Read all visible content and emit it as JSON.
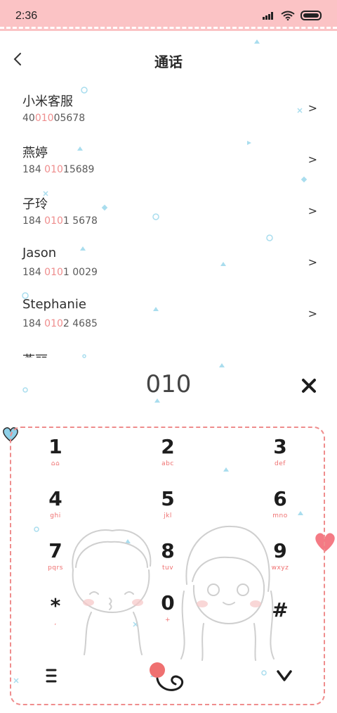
{
  "status_bar": {
    "time": "2:36"
  },
  "header": {
    "title": "通话"
  },
  "contacts": [
    {
      "name": "小米客服",
      "number_pre": "40",
      "number_match": "010",
      "number_post": "05678"
    },
    {
      "name": "燕婷",
      "number_pre": "184 ",
      "number_match": "010",
      "number_post": "15689"
    },
    {
      "name": "子玲",
      "number_pre": "184 ",
      "number_match": "010",
      "number_post": "1 5678"
    },
    {
      "name": "Jason",
      "number_pre": "184 ",
      "number_match": "010",
      "number_post": "1 0029"
    },
    {
      "name": "Stephanie",
      "number_pre": "184 ",
      "number_match": "010",
      "number_post": "2 4685"
    }
  ],
  "contact_partial": "燕丽",
  "contact_arrow": ">",
  "dial": {
    "input": "010"
  },
  "keypad": {
    "keys": [
      {
        "digit": "1",
        "letters": "⌂⌂"
      },
      {
        "digit": "2",
        "letters": "abc"
      },
      {
        "digit": "3",
        "letters": "def"
      },
      {
        "digit": "4",
        "letters": "ghi"
      },
      {
        "digit": "5",
        "letters": "jkl"
      },
      {
        "digit": "6",
        "letters": "mno"
      },
      {
        "digit": "7",
        "letters": "pqrs"
      },
      {
        "digit": "8",
        "letters": "tuv"
      },
      {
        "digit": "9",
        "letters": "wxyz"
      },
      {
        "digit": "*",
        "letters": ","
      },
      {
        "digit": "0",
        "letters": "+"
      },
      {
        "digit": "#",
        "letters": ""
      }
    ]
  },
  "colors": {
    "status_bg": "#fbc3c5",
    "accent": "#ef8d8d",
    "heart_blue": "#8ed0e8",
    "heart_pink": "#f47a84"
  },
  "icons": {
    "back": "chevron-left-icon",
    "delete": "close-icon",
    "menu": "menu-icon",
    "call": "phone-call-icon",
    "collapse": "chevron-down-icon"
  }
}
